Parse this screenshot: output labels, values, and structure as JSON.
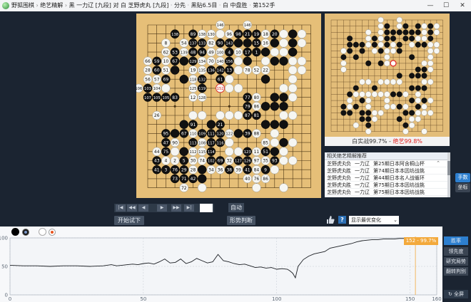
{
  "window": {
    "app_name": "野狐围棋",
    "section": "绝艺精解",
    "title_parts": [
      "黑 一力辽 [九段] 对 白 芝野虎丸 [九段]",
      "分先",
      "黑贴6.5目",
      "白 中盘胜",
      "第152手"
    ]
  },
  "colors": {
    "accent_blue": "#2d7fcf",
    "winrate_red": "#e02020",
    "tip_orange": "#f3a93b"
  },
  "board": {
    "size": 19,
    "black": [
      [
        9,
        1
      ],
      [
        12,
        1
      ],
      [
        14,
        1
      ],
      [
        16,
        1
      ],
      [
        12,
        2
      ],
      [
        16,
        2
      ],
      [
        9,
        2
      ],
      [
        13,
        2
      ],
      [
        10,
        2
      ],
      [
        14,
        2
      ],
      [
        11,
        2
      ],
      [
        3,
        3
      ],
      [
        7,
        3
      ],
      [
        9,
        3
      ],
      [
        10,
        3
      ],
      [
        12,
        3
      ],
      [
        13,
        3
      ],
      [
        16,
        3
      ],
      [
        9,
        4
      ],
      [
        11,
        4
      ],
      [
        14,
        4
      ],
      [
        3,
        4
      ],
      [
        4,
        4
      ],
      [
        5,
        4
      ],
      [
        7,
        4
      ],
      [
        15,
        4
      ],
      [
        3,
        5
      ],
      [
        5,
        5
      ],
      [
        8,
        5
      ],
      [
        11,
        5
      ],
      [
        2,
        6
      ],
      [
        4,
        6
      ],
      [
        13,
        6
      ],
      [
        8,
        7
      ],
      [
        6,
        7
      ],
      [
        15,
        8
      ],
      [
        14,
        8
      ],
      [
        14,
        9
      ],
      [
        11,
        9
      ],
      [
        13,
        9
      ],
      [
        15,
        9
      ],
      [
        7,
        11
      ],
      [
        13,
        11
      ],
      [
        14,
        11
      ],
      [
        15,
        11
      ],
      [
        4,
        11
      ],
      [
        3,
        12
      ],
      [
        11,
        12
      ],
      [
        10,
        12
      ],
      [
        5,
        13
      ],
      [
        13,
        13
      ],
      [
        15,
        13
      ],
      [
        2,
        14
      ],
      [
        4,
        14
      ],
      [
        11,
        14
      ],
      [
        14,
        14
      ],
      [
        2,
        15
      ],
      [
        3,
        15
      ],
      [
        5,
        15
      ],
      [
        6,
        15
      ],
      [
        12,
        15
      ],
      [
        13,
        15
      ],
      [
        5,
        16
      ],
      [
        6,
        16
      ],
      [
        11,
        16
      ],
      [
        6,
        17
      ],
      [
        12,
        17
      ]
    ],
    "white": [
      [
        8,
        0
      ],
      [
        11,
        0
      ],
      [
        8,
        1
      ],
      [
        11,
        1
      ],
      [
        15,
        1
      ],
      [
        17,
        1
      ],
      [
        6,
        2
      ],
      [
        8,
        2
      ],
      [
        15,
        2
      ],
      [
        17,
        2
      ],
      [
        6,
        3
      ],
      [
        8,
        3
      ],
      [
        14,
        3
      ],
      [
        15,
        3
      ],
      [
        6,
        4
      ],
      [
        8,
        4
      ],
      [
        10,
        4
      ],
      [
        17,
        4
      ],
      [
        13,
        4
      ],
      [
        16,
        4
      ],
      [
        2,
        5
      ],
      [
        9,
        5
      ],
      [
        10,
        5
      ],
      [
        7,
        5
      ],
      [
        17,
        5
      ],
      [
        16,
        5
      ],
      [
        2,
        7
      ],
      [
        9,
        6
      ],
      [
        15,
        7
      ],
      [
        10,
        7
      ],
      [
        9,
        7
      ],
      [
        16,
        6
      ],
      [
        16,
        7
      ],
      [
        2,
        8
      ],
      [
        16,
        8
      ],
      [
        16,
        10
      ],
      [
        5,
        10
      ],
      [
        6,
        10
      ],
      [
        8,
        10
      ],
      [
        9,
        10
      ],
      [
        10,
        10
      ],
      [
        11,
        10
      ],
      [
        15,
        10
      ],
      [
        4,
        12
      ],
      [
        5,
        12
      ],
      [
        6,
        12
      ],
      [
        7,
        12
      ],
      [
        8,
        12
      ],
      [
        9,
        12
      ],
      [
        12,
        12
      ],
      [
        14,
        12
      ],
      [
        3,
        13
      ],
      [
        6,
        13
      ],
      [
        9,
        13
      ],
      [
        14,
        13
      ],
      [
        16,
        13
      ],
      [
        3,
        14
      ],
      [
        6,
        14
      ],
      [
        9,
        14
      ],
      [
        10,
        14
      ],
      [
        12,
        14
      ],
      [
        15,
        14
      ],
      [
        7,
        15
      ],
      [
        8,
        15
      ],
      [
        14,
        15
      ],
      [
        15,
        15
      ],
      [
        16,
        15
      ],
      [
        7,
        16
      ],
      [
        13,
        16
      ],
      [
        14,
        16
      ],
      [
        4,
        17
      ],
      [
        13,
        17
      ],
      [
        6,
        18
      ],
      [
        12,
        18
      ],
      [
        15,
        18
      ]
    ],
    "labeled": [
      [
        "146",
        8,
        0,
        "w"
      ],
      [
        "146",
        11,
        0,
        "w"
      ],
      [
        "131",
        3,
        1,
        "b"
      ],
      [
        "138",
        3,
        1,
        "b"
      ],
      [
        "96",
        9,
        1,
        "w"
      ],
      [
        "98",
        10,
        1,
        "b"
      ],
      [
        "21",
        11,
        1,
        "b"
      ],
      [
        "19",
        12,
        1,
        "b"
      ],
      [
        "18",
        13,
        1,
        "w"
      ],
      [
        "20",
        14,
        1,
        "b"
      ],
      [
        "89",
        5,
        1,
        "b"
      ],
      [
        "138",
        6,
        1,
        "w"
      ],
      [
        "130",
        7,
        1,
        "w"
      ],
      [
        "8",
        2,
        2,
        "w"
      ],
      [
        "54",
        4,
        2,
        "w"
      ],
      [
        "137",
        5,
        2,
        "b"
      ],
      [
        "133",
        6,
        2,
        "b"
      ],
      [
        "82",
        7,
        2,
        "w"
      ],
      [
        "90",
        8,
        2,
        "b"
      ],
      [
        "143",
        9,
        2,
        "b"
      ],
      [
        "15",
        12,
        2,
        "b"
      ],
      [
        "16",
        13,
        2,
        "w"
      ],
      [
        "62",
        2,
        3,
        "w"
      ],
      [
        "53",
        3,
        3,
        "b"
      ],
      [
        "139",
        4,
        3,
        "w"
      ],
      [
        "48",
        5,
        3,
        "b"
      ],
      [
        "94",
        6,
        3,
        "b"
      ],
      [
        "49",
        7,
        3,
        "w"
      ],
      [
        "100",
        8,
        3,
        "w"
      ],
      [
        "4",
        9,
        3,
        "b"
      ],
      [
        "10",
        10,
        3,
        "w"
      ],
      [
        "17",
        11,
        3,
        "b"
      ],
      [
        "1",
        12,
        3,
        "b"
      ],
      [
        "66",
        0,
        4,
        "w"
      ],
      [
        "59",
        1,
        4,
        "b"
      ],
      [
        "10",
        2,
        4,
        "w"
      ],
      [
        "67",
        3,
        4,
        "b"
      ],
      [
        "129",
        5,
        4,
        "b"
      ],
      [
        "134",
        6,
        4,
        "w"
      ],
      [
        "70",
        7,
        4,
        "w"
      ],
      [
        "140",
        8,
        4,
        "w"
      ],
      [
        "156",
        9,
        4,
        "b"
      ],
      [
        "28",
        0,
        5,
        "w"
      ],
      [
        "60",
        1,
        5,
        "b"
      ],
      [
        "51",
        2,
        5,
        "w"
      ],
      [
        "19",
        5,
        5,
        "w"
      ],
      [
        "135",
        6,
        5,
        "w"
      ],
      [
        "136",
        7,
        5,
        "b"
      ],
      [
        "142",
        8,
        5,
        "b"
      ],
      [
        "13",
        9,
        5,
        "b"
      ],
      [
        "78",
        11,
        5,
        "w"
      ],
      [
        "52",
        12,
        5,
        "w"
      ],
      [
        "22",
        13,
        5,
        "w"
      ],
      [
        "56",
        0,
        6,
        "w"
      ],
      [
        "57",
        1,
        6,
        "w"
      ],
      [
        "69",
        2,
        6,
        "b"
      ],
      [
        "118",
        5,
        6,
        "w"
      ],
      [
        "132",
        6,
        6,
        "b"
      ],
      [
        "61",
        8,
        6,
        "b"
      ],
      [
        "106",
        -1,
        7,
        "w"
      ],
      [
        "103",
        0,
        7,
        "b"
      ],
      [
        "104",
        1,
        7,
        "w"
      ],
      [
        "125",
        5,
        7,
        "w"
      ],
      [
        "119",
        6,
        7,
        "b"
      ],
      [
        "152",
        8,
        7,
        "mark"
      ],
      [
        "107",
        0,
        8,
        "b"
      ],
      [
        "105",
        1,
        8,
        "b"
      ],
      [
        "105",
        2,
        8,
        "b"
      ],
      [
        "83",
        3,
        8,
        "b"
      ],
      [
        "12",
        5,
        8,
        "w"
      ],
      [
        "128",
        6,
        8,
        "w"
      ],
      [
        "77",
        11,
        8,
        "b"
      ],
      [
        "80",
        12,
        8,
        "w"
      ],
      [
        "79",
        11,
        9,
        "b"
      ],
      [
        "86",
        12,
        9,
        "w"
      ],
      [
        "26",
        1,
        10,
        "w"
      ],
      [
        "87",
        11,
        10,
        "b"
      ],
      [
        "81",
        12,
        10,
        "b"
      ],
      [
        "91",
        5,
        11,
        "b"
      ],
      [
        "21",
        8,
        11,
        "b"
      ],
      [
        "95",
        2,
        12,
        "b"
      ],
      [
        "67",
        4,
        12,
        "b"
      ],
      [
        "110",
        5,
        12,
        "w"
      ],
      [
        "109",
        6,
        12,
        "b"
      ],
      [
        "111",
        7,
        12,
        "b"
      ],
      [
        "120",
        8,
        12,
        "b"
      ],
      [
        "122",
        9,
        12,
        "w"
      ],
      [
        "39",
        11,
        12,
        "b"
      ],
      [
        "88",
        12,
        12,
        "w"
      ],
      [
        "47",
        2,
        13,
        "b"
      ],
      [
        "90",
        3,
        13,
        "w"
      ],
      [
        "113",
        5,
        13,
        "b"
      ],
      [
        "108",
        6,
        13,
        "w"
      ],
      [
        "117",
        7,
        13,
        "b"
      ],
      [
        "116",
        8,
        13,
        "b"
      ],
      [
        "85",
        13,
        13,
        "w"
      ],
      [
        "44",
        1,
        14,
        "w"
      ],
      [
        "75",
        2,
        14,
        "b"
      ],
      [
        "112",
        5,
        14,
        "w"
      ],
      [
        "115",
        6,
        14,
        "w"
      ],
      [
        "114",
        7,
        14,
        "b"
      ],
      [
        "123",
        11,
        14,
        "b"
      ],
      [
        "11",
        12,
        14,
        "w"
      ],
      [
        "51",
        13,
        14,
        "b"
      ],
      [
        "43",
        1,
        15,
        "b"
      ],
      [
        "4",
        2,
        15,
        "w"
      ],
      [
        "2",
        3,
        15,
        "w"
      ],
      [
        "5",
        4,
        15,
        "b"
      ],
      [
        "30",
        5,
        15,
        "w"
      ],
      [
        "74",
        6,
        15,
        "w"
      ],
      [
        "102",
        7,
        15,
        "b"
      ],
      [
        "69",
        8,
        15,
        "b"
      ],
      [
        "32",
        9,
        15,
        "w"
      ],
      [
        "127",
        10,
        15,
        "b"
      ],
      [
        "126",
        11,
        15,
        "b"
      ],
      [
        "97",
        12,
        15,
        "w"
      ],
      [
        "35",
        13,
        15,
        "w"
      ],
      [
        "93",
        14,
        15,
        "b"
      ],
      [
        "41",
        1,
        16,
        "b"
      ],
      [
        "3",
        2,
        16,
        "b"
      ],
      [
        "76",
        3,
        16,
        "b"
      ],
      [
        "29",
        4,
        16,
        "b"
      ],
      [
        "28",
        5,
        16,
        "w"
      ],
      [
        "34",
        7,
        16,
        "w"
      ],
      [
        "36",
        8,
        16,
        "w"
      ],
      [
        "38",
        9,
        16,
        "b"
      ],
      [
        "39",
        10,
        16,
        "w"
      ],
      [
        "41",
        11,
        16,
        "b"
      ],
      [
        "84",
        12,
        16,
        "w"
      ],
      [
        "9",
        13,
        16,
        "b"
      ],
      [
        "73",
        3,
        17,
        "b"
      ],
      [
        "71",
        4,
        17,
        "b"
      ],
      [
        "42",
        5,
        17,
        "b"
      ],
      [
        "40",
        11,
        17,
        "w"
      ],
      [
        "76",
        12,
        17,
        "w"
      ],
      [
        "86",
        13,
        17,
        "w"
      ],
      [
        "72",
        4,
        18,
        "w"
      ]
    ]
  },
  "mini_status": {
    "prefix": "白实战99.7%",
    "dash": " - ",
    "label": "绝艺99.8%"
  },
  "recommend": {
    "header": "相关绝艺精解推荐",
    "more": "⌃",
    "rows": [
      {
        "white": "芝野虎丸",
        "r": "负",
        "black": "一力辽",
        "event": "第25期日本阿含桐山杯"
      },
      {
        "white": "芝野虎丸",
        "r": "胜",
        "black": "一力辽",
        "event": "第74期日本本因坊战挑"
      },
      {
        "white": "芝野虎丸",
        "r": "负",
        "black": "一力辽",
        "event": "第44期日本名人战循环"
      },
      {
        "white": "芝野虎丸",
        "r": "胜",
        "black": "一力辽",
        "event": "第75期日本本因坊战挑"
      },
      {
        "white": "芝野虎丸",
        "r": "负",
        "black": "一力辽",
        "event": "第75期日本本因坊战挑"
      }
    ]
  },
  "side_tabs": {
    "tab1": "手数",
    "tab2": "坐标"
  },
  "nav": {
    "first": "|◀",
    "fast_back": "◀◀",
    "back": "◀",
    "forward": "▶",
    "fast_forward": "▶▶",
    "last": "▶|",
    "move_value": "",
    "auto": "自动"
  },
  "buttons": {
    "try": "开始试下",
    "judge": "形势判断"
  },
  "variation": {
    "selected": "显示最优变化",
    "arrow": "⌄"
  },
  "graph": {
    "y_ticks": [
      "100",
      "50",
      "0"
    ],
    "x_ticks": [
      "0",
      "50",
      "100",
      "150",
      "160"
    ],
    "tip": "152 - 99.7%"
  },
  "right_col": {
    "b1": "胜率",
    "b2": "领先度",
    "b3": "研究局势",
    "b4": "翻转判别",
    "b5": "↻ 全屏"
  },
  "chart_data": {
    "type": "line",
    "title": "",
    "xlabel": "",
    "ylabel": "",
    "xlim": [
      0,
      160
    ],
    "ylim": [
      0,
      100
    ],
    "x_ticks": [
      0,
      50,
      100,
      150,
      160
    ],
    "y_ticks": [
      0,
      50,
      100
    ],
    "series": [
      {
        "x": [
          0,
          5,
          10,
          15,
          20,
          25,
          30,
          35,
          38,
          40,
          42,
          44,
          46,
          48,
          50,
          52,
          54,
          56,
          58,
          60,
          62,
          64,
          66,
          68,
          70,
          72,
          74,
          76,
          78,
          80,
          82,
          84,
          86,
          88,
          90,
          92,
          94,
          96,
          98,
          100,
          102,
          104,
          105,
          106,
          107,
          108,
          110,
          112,
          114,
          116,
          118,
          120,
          122,
          124,
          126,
          128,
          130,
          132,
          134,
          136,
          138,
          140,
          142,
          144,
          146,
          148,
          150,
          152
        ],
        "y": [
          52,
          51,
          51,
          50,
          51,
          51,
          50,
          51,
          53,
          51,
          52,
          53,
          54,
          53,
          55,
          56,
          54,
          58,
          63,
          56,
          57,
          63,
          55,
          58,
          64,
          60,
          56,
          58,
          71,
          60,
          58,
          55,
          53,
          54,
          51,
          48,
          49,
          47,
          48,
          45,
          46,
          45,
          42,
          38,
          30,
          50,
          62,
          68,
          72,
          74,
          76,
          82,
          84,
          86,
          88,
          90,
          93,
          95,
          96,
          97,
          97,
          98,
          98,
          98,
          99,
          99,
          99,
          99.7
        ]
      }
    ]
  }
}
